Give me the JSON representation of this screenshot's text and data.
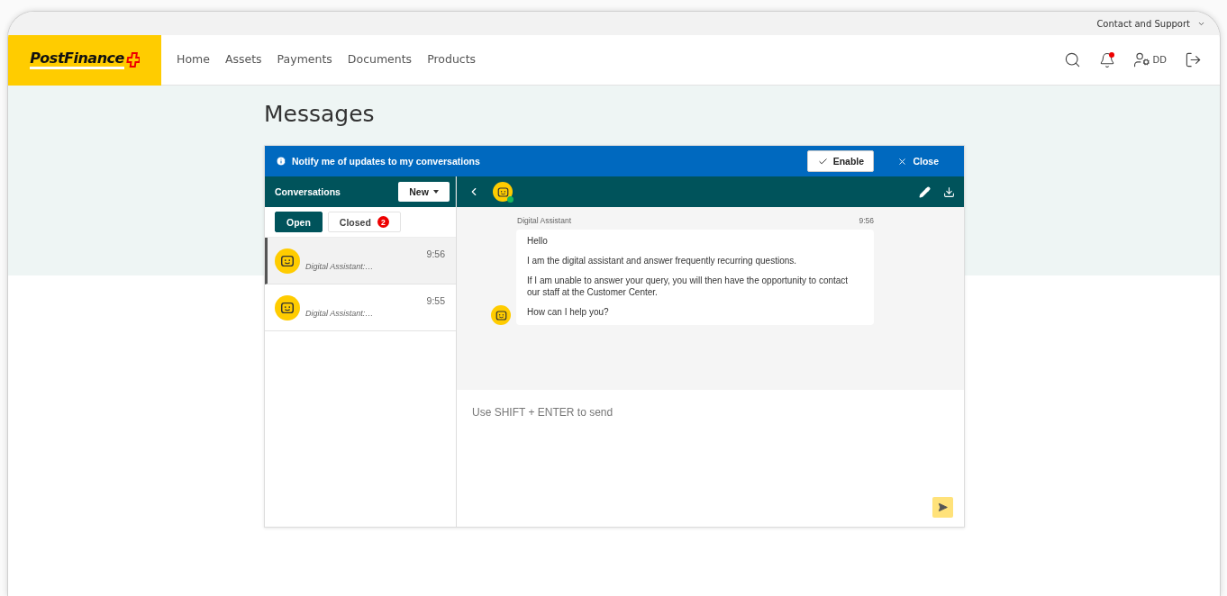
{
  "top_bar": {
    "link": "Contact and Support"
  },
  "header": {
    "logo": "PostFinance",
    "nav": [
      {
        "label": "Home",
        "selected": false
      },
      {
        "label": "Assets",
        "selected": false
      },
      {
        "label": "Payments",
        "selected": false
      },
      {
        "label": "Documents",
        "selected": false
      },
      {
        "label": "Products",
        "selected": false
      }
    ],
    "notifications_unread": true,
    "user_initials": "DD"
  },
  "page_title": "Messages",
  "notify_bar": {
    "text": "Notify me of updates to my conversations",
    "enable": "Enable",
    "close": "Close"
  },
  "conversations": {
    "title": "Conversations",
    "new_button": "New",
    "tabs": [
      {
        "label": "Open",
        "selected": true
      },
      {
        "label": "Closed",
        "badge": "2",
        "selected": false
      }
    ],
    "items": [
      {
        "preview": "Digital Assistant:…",
        "time": "9:56",
        "selected": true
      },
      {
        "preview": "Digital Assistant:…",
        "time": "9:55",
        "selected": false
      }
    ]
  },
  "chat": {
    "assistant_online": true,
    "messages": [
      {
        "sender": "Digital Assistant",
        "time": "9:56",
        "paragraphs": [
          "Hello",
          "I am the digital assistant and answer frequently recurring questions.",
          "If I am unable to answer your query, you will then have the opportunity to contact our staff at the Customer Center.",
          "How can I help you?"
        ]
      }
    ],
    "composer": {
      "placeholder": "Use SHIFT + ENTER to send"
    }
  }
}
